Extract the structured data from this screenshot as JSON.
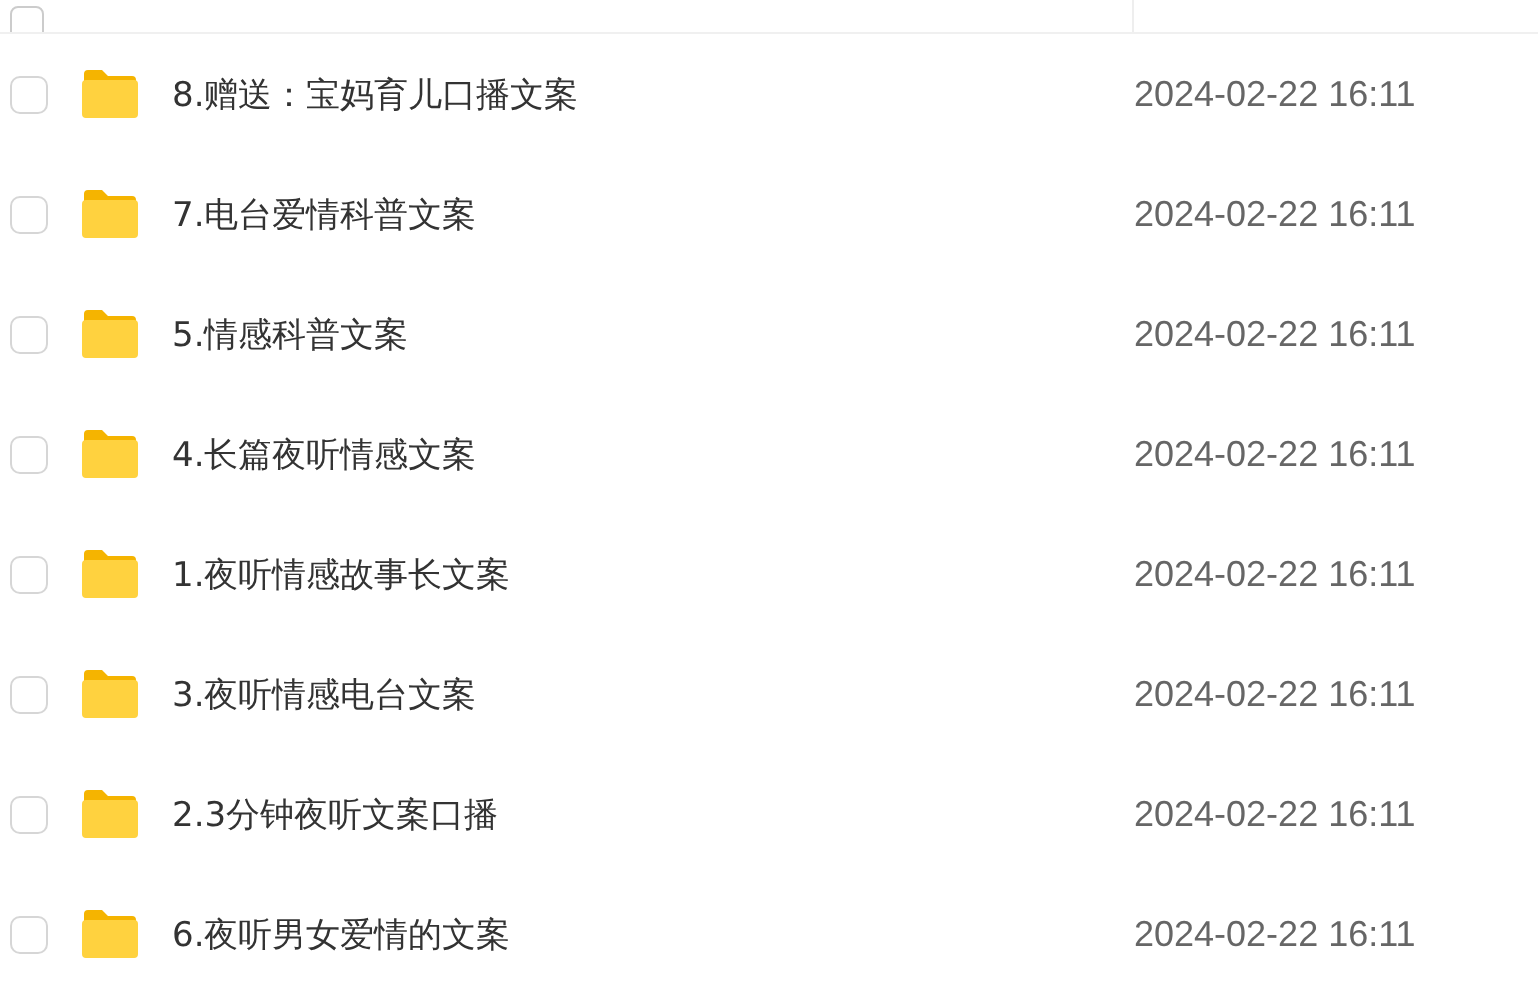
{
  "header": {
    "checked": false
  },
  "rows": [
    {
      "name": "8.赠送：宝妈育儿口播文案",
      "modified": "2024-02-22 16:11",
      "checked": false
    },
    {
      "name": "7.电台爱情科普文案",
      "modified": "2024-02-22 16:11",
      "checked": false
    },
    {
      "name": "5.情感科普文案",
      "modified": "2024-02-22 16:11",
      "checked": false
    },
    {
      "name": "4.长篇夜听情感文案",
      "modified": "2024-02-22 16:11",
      "checked": false
    },
    {
      "name": "1.夜听情感故事长文案",
      "modified": "2024-02-22 16:11",
      "checked": false
    },
    {
      "name": "3.夜听情感电台文案",
      "modified": "2024-02-22 16:11",
      "checked": false
    },
    {
      "name": "2.3分钟夜听文案口播",
      "modified": "2024-02-22 16:11",
      "checked": false
    },
    {
      "name": "6.夜听男女爱情的文案",
      "modified": "2024-02-22 16:11",
      "checked": false
    }
  ]
}
